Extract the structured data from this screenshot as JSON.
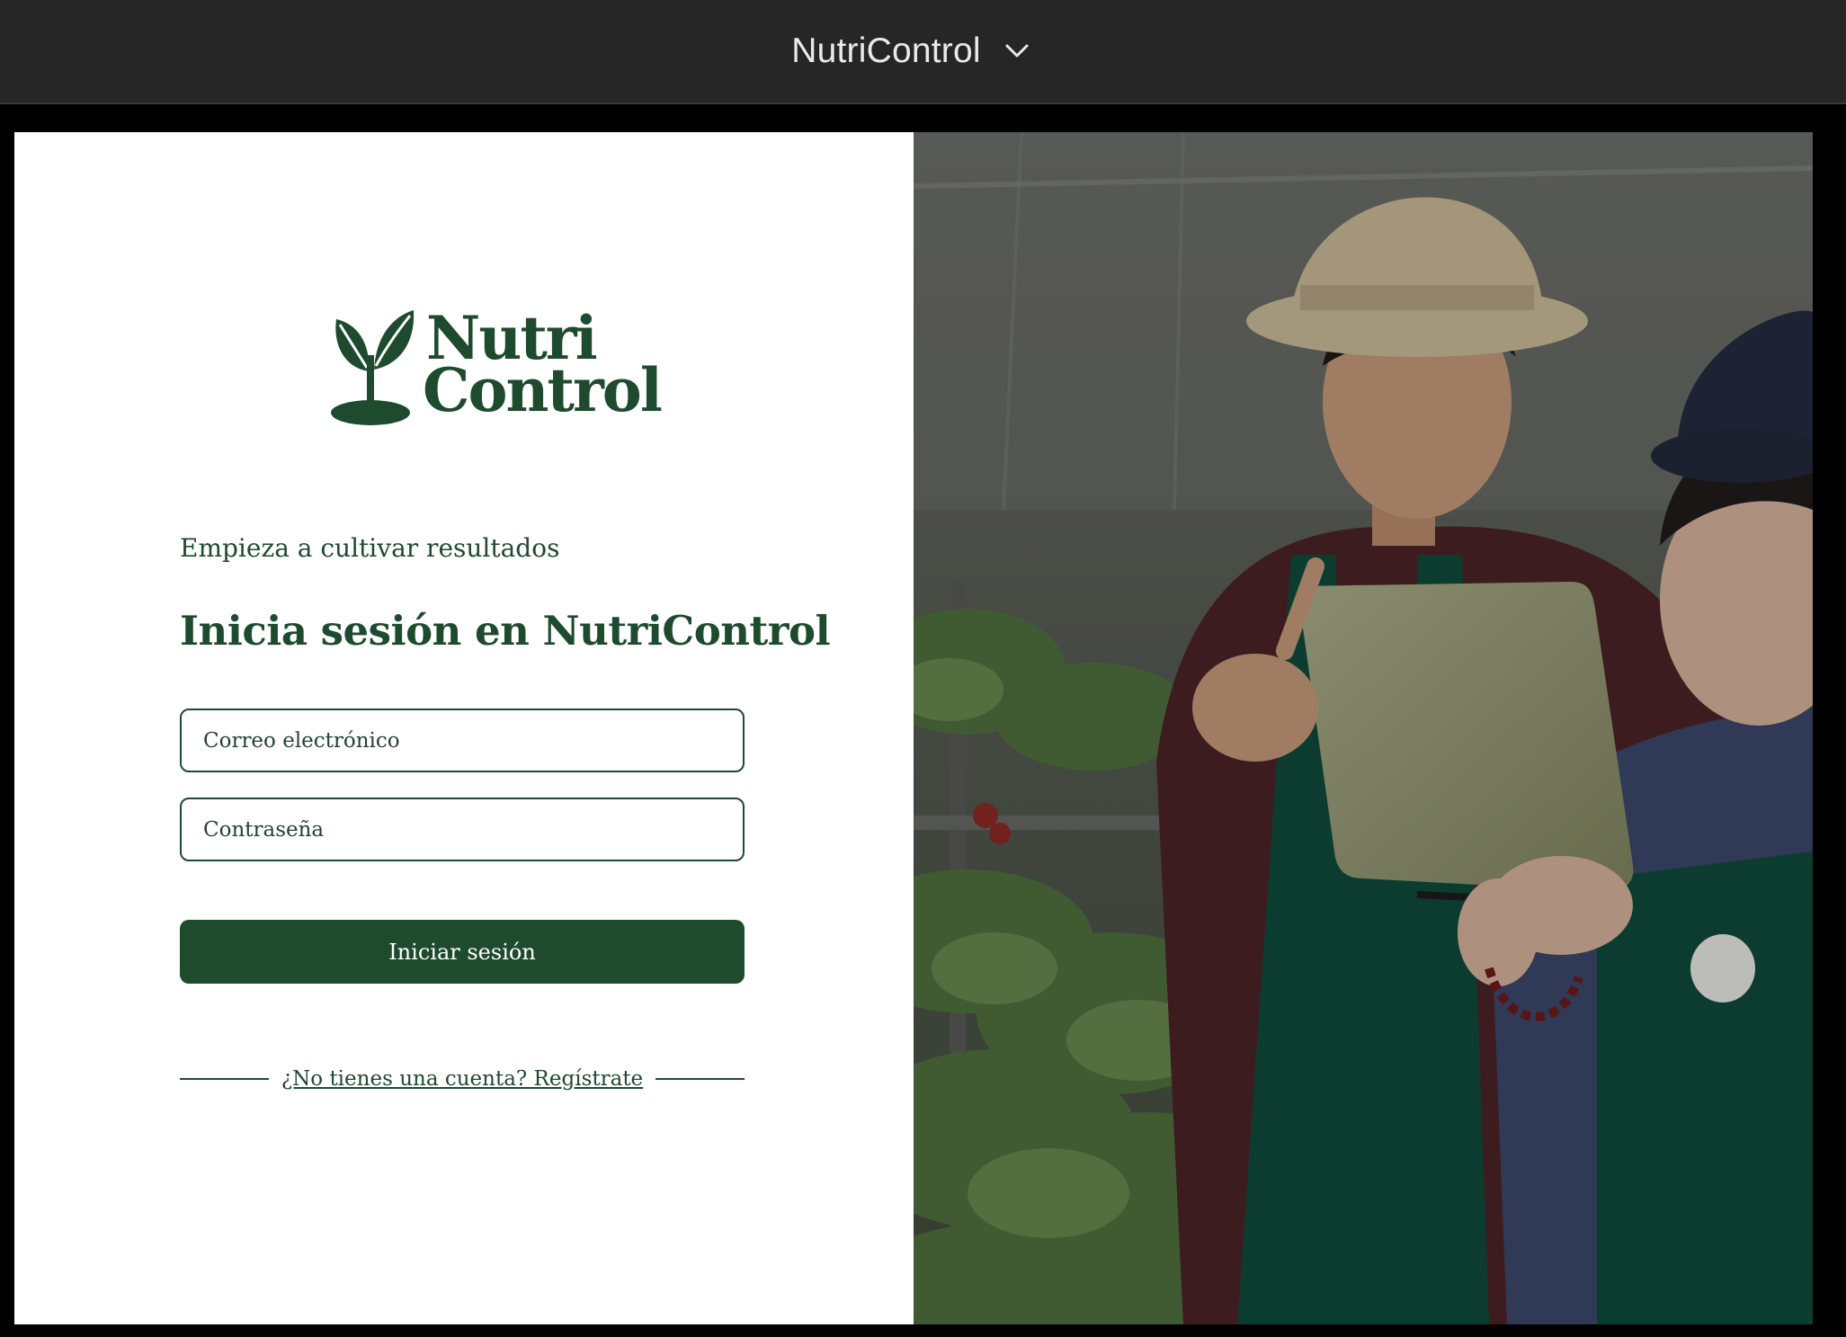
{
  "window": {
    "title": "NutriControl",
    "title_menu_icon": "chevron-down-icon"
  },
  "brand": {
    "logo_line1": "Nutri",
    "logo_line2": "Control",
    "logo_icon": "sprout-icon",
    "color_primary": "#1e4a2e"
  },
  "login": {
    "tagline": "Empieza a cultivar resultados",
    "heading": "Inicia sesión en NutriControl",
    "email_placeholder": "Correo electrónico",
    "email_value": "",
    "password_placeholder": "Contraseña",
    "password_value": "",
    "submit_label": "Iniciar sesión",
    "register_link": "¿No tienes una cuenta? Regístrate"
  },
  "hero_image": {
    "subject": "photo"
  }
}
